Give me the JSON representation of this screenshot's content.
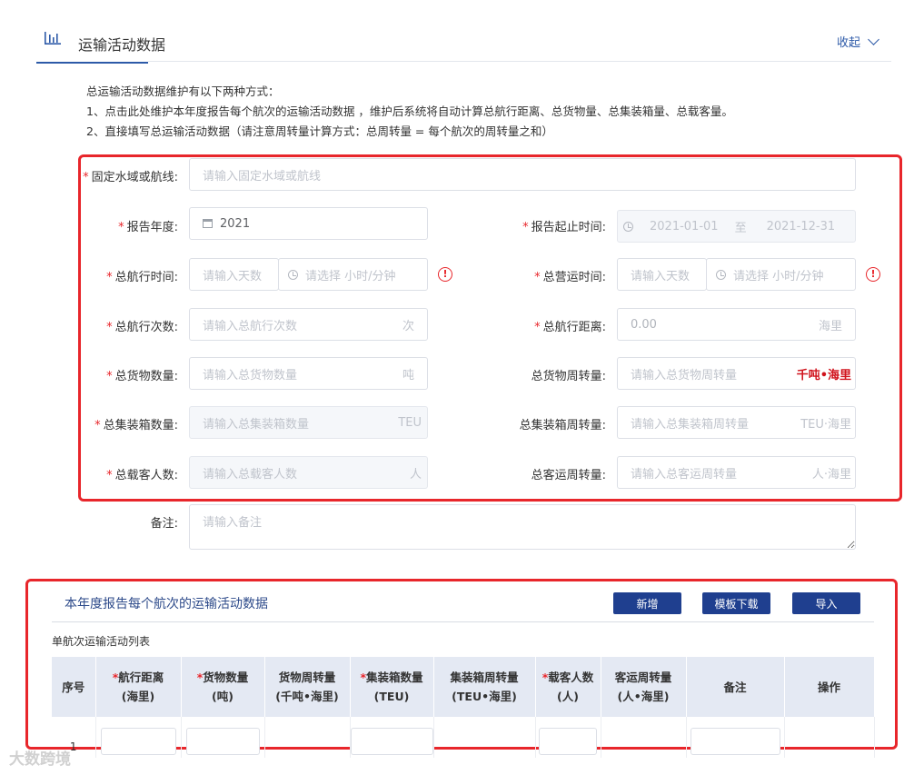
{
  "header": {
    "title": "运输活动数据",
    "collapse_label": "收起"
  },
  "notes": {
    "intro": "总运输活动数据维护有以下两种方式：",
    "line1": "1、点击此处维护本年度报告每个航次的运输活动数据 ，维护后系统将自动计算总航行距离、总货物量、总集装箱量、总载客量。",
    "line2": "2、直接填写总运输活动数据（请注意周转量计算方式：总周转量 = 每个航次的周转量之和）"
  },
  "form": {
    "route": {
      "label": "固定水域或航线:",
      "placeholder": "请输入固定水域或航线"
    },
    "report_year": {
      "label": "报告年度:",
      "value": "2021"
    },
    "report_period": {
      "label": "报告起止时间:",
      "start": "2021-01-01",
      "sep": "至",
      "end": "2021-12-31"
    },
    "total_sail_time": {
      "label": "总航行时间:",
      "days_placeholder": "请输入天数",
      "time_placeholder": "请选择 小时/分钟"
    },
    "total_operate_time": {
      "label": "总营运时间:",
      "days_placeholder": "请输入天数",
      "time_placeholder": "请选择 小时/分钟"
    },
    "total_voyages": {
      "label": "总航行次数:",
      "placeholder": "请输入总航行次数",
      "unit": "次"
    },
    "total_distance": {
      "label": "总航行距离:",
      "value": "0.00",
      "unit": "海里"
    },
    "total_cargo": {
      "label": "总货物数量:",
      "placeholder": "请输入总货物数量",
      "unit": "吨"
    },
    "cargo_turnover": {
      "label": "总货物周转量:",
      "placeholder": "请输入总货物周转量",
      "unit": "千吨•海里"
    },
    "total_containers": {
      "label": "总集装箱数量:",
      "placeholder": "请输入总集装箱数量",
      "unit": "TEU"
    },
    "container_turnover": {
      "label": "总集装箱周转量:",
      "placeholder": "请输入总集装箱周转量",
      "unit": "TEU·海里"
    },
    "total_passengers": {
      "label": "总载客人数:",
      "placeholder": "请输入总载客人数",
      "unit": "人"
    },
    "passenger_turnover": {
      "label": "总客运周转量:",
      "placeholder": "请输入总客运周转量",
      "unit": "人·海里"
    },
    "remark": {
      "label": "备注:",
      "placeholder": "请输入备注"
    },
    "required_mark": "*",
    "warn_glyph": "!"
  },
  "voyages": {
    "title": "本年度报告每个航次的运输活动数据",
    "buttons": {
      "add": "新增",
      "template": "模板下载",
      "import": "导入"
    },
    "list_title": "单航次运输活动列表",
    "columns": [
      {
        "line1": "序号",
        "line2": "",
        "required": false
      },
      {
        "line1": "航行距离",
        "line2": "(海里)",
        "required": true
      },
      {
        "line1": "货物数量",
        "line2": "(吨)",
        "required": true
      },
      {
        "line1": "货物周转量",
        "line2": "(千吨•海里)",
        "required": false
      },
      {
        "line1": "集装箱数量",
        "line2": "(TEU)",
        "required": true
      },
      {
        "line1": "集装箱周转量",
        "line2": "(TEU•海里)",
        "required": false
      },
      {
        "line1": "载客人数",
        "line2": "(人)",
        "required": true
      },
      {
        "line1": "客运周转量",
        "line2": "(人•海里)",
        "required": false
      },
      {
        "line1": "备注",
        "line2": "",
        "required": false
      },
      {
        "line1": "操作",
        "line2": "",
        "required": false
      }
    ],
    "rows": [
      {
        "index": "1"
      }
    ]
  },
  "watermark": "大数跨境",
  "colors": {
    "accent": "#2d5aa8",
    "button": "#1f3f8f",
    "required": "#e8262b",
    "highlight_box": "#e8262b",
    "header_bg": "#e4e9f3"
  }
}
